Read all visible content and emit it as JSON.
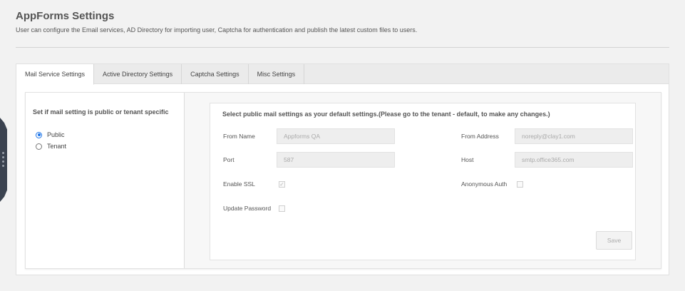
{
  "page": {
    "title": "AppForms Settings",
    "description": "User can configure the Email services, AD Directory for importing user, Captcha for authentication and publish the latest custom files to users."
  },
  "tabs": [
    {
      "label": "Mail Service Settings",
      "active": true
    },
    {
      "label": "Active Directory Settings",
      "active": false
    },
    {
      "label": "Captcha Settings",
      "active": false
    },
    {
      "label": "Misc Settings",
      "active": false
    }
  ],
  "left_panel": {
    "heading": "Set if mail setting is public or tenant specific",
    "options": [
      {
        "label": "Public",
        "selected": true
      },
      {
        "label": "Tenant",
        "selected": false
      }
    ]
  },
  "right_panel": {
    "heading": "Select public mail settings as your default settings.(Please go to the tenant - default, to make any changes.)",
    "fields": {
      "from_name": {
        "label": "From Name",
        "value": "Appforms QA"
      },
      "from_address": {
        "label": "From Address",
        "value": "noreply@clay1.com"
      },
      "port": {
        "label": "Port",
        "value": "587"
      },
      "host": {
        "label": "Host",
        "value": "smtp.office365.com"
      },
      "enable_ssl": {
        "label": "Enable SSL",
        "checked": true
      },
      "anonymous_auth": {
        "label": "Anonymous Auth",
        "checked": false
      },
      "update_password": {
        "label": "Update Password",
        "checked": false
      }
    },
    "save_label": "Save"
  },
  "colors": {
    "background": "#f2f2f2",
    "radio_accent": "#1a73e8",
    "side_handle": "#3b4350"
  }
}
